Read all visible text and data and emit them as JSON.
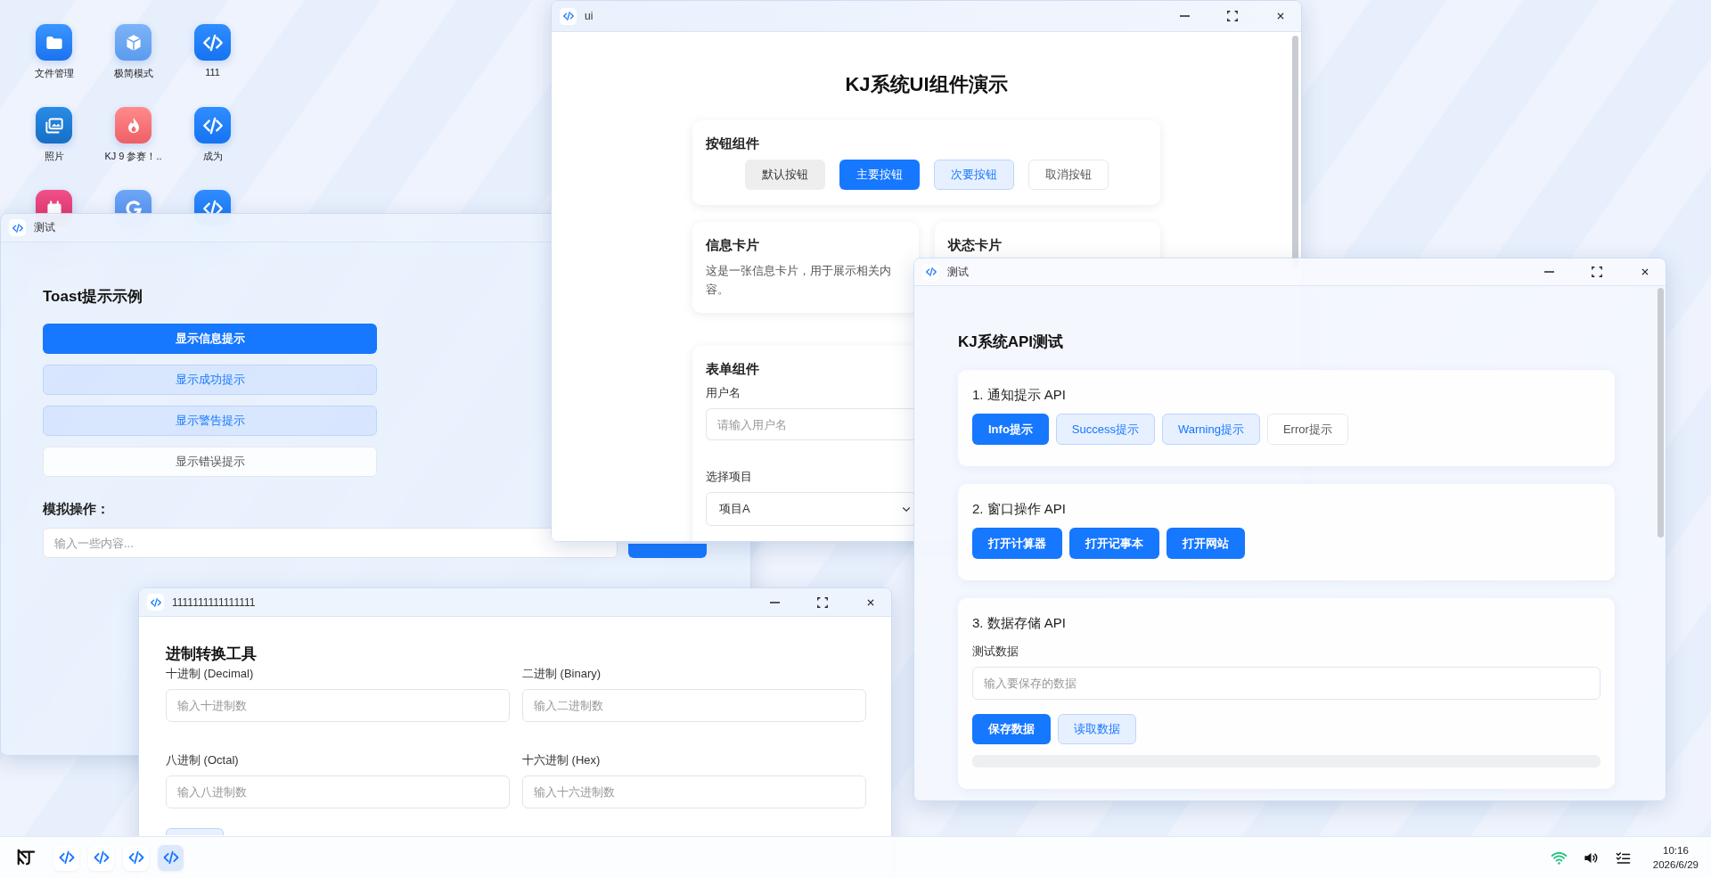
{
  "desktop_icons": [
    {
      "label": "文件管理",
      "kind": "folder"
    },
    {
      "label": "极简模式",
      "kind": "cube"
    },
    {
      "label": "111",
      "kind": "code"
    },
    {
      "label": "照片",
      "kind": "photos"
    },
    {
      "label": "KJ 9 参赛！..",
      "kind": "flame"
    },
    {
      "label": "成为",
      "kind": "code"
    },
    {
      "kind": "calendar"
    },
    {
      "kind": "g"
    },
    {
      "kind": "code"
    }
  ],
  "toast_window": {
    "title": "测试",
    "heading": "Toast提示示例",
    "buttons": [
      {
        "label": "显示信息提示",
        "kind": "primary"
      },
      {
        "label": "显示成功提示",
        "kind": "secondary"
      },
      {
        "label": "显示警告提示",
        "kind": "secondary"
      },
      {
        "label": "显示错误提示",
        "kind": "plain"
      }
    ],
    "section_label": "模拟操作：",
    "input_placeholder": "输入一些内容..."
  },
  "ui_window": {
    "title": "ui",
    "heading": "KJ系统UI组件演示",
    "button_card": {
      "title": "按钮组件",
      "buttons": [
        {
          "label": "默认按钮",
          "kind": "default"
        },
        {
          "label": "主要按钮",
          "kind": "primary"
        },
        {
          "label": "次要按钮",
          "kind": "secondary"
        },
        {
          "label": "取消按钮",
          "kind": "plain"
        }
      ]
    },
    "info_card": {
      "title": "信息卡片",
      "text": "这是一张信息卡片，用于展示相关内容。"
    },
    "status_card": {
      "title": "状态卡片"
    },
    "form_card": {
      "title": "表单组件",
      "fields": [
        {
          "label": "用户名",
          "kind": "text",
          "placeholder": "请输入用户名"
        },
        {
          "label": "选择项目",
          "kind": "select",
          "value": "项目A"
        }
      ]
    }
  },
  "converter_window": {
    "title": "1111111111111111",
    "heading": "进制转换工具",
    "fields": [
      {
        "label": "十进制 (Decimal)",
        "placeholder": "输入十进制数"
      },
      {
        "label": "二进制 (Binary)",
        "placeholder": "输入二进制数"
      },
      {
        "label": "八进制 (Octal)",
        "placeholder": "输入八进制数"
      },
      {
        "label": "十六进制 (Hex)",
        "placeholder": "输入十六进制数"
      }
    ]
  },
  "api_window": {
    "title": "测试",
    "heading": "KJ系统API测试",
    "sections": [
      {
        "title": "1. 通知提示 API",
        "buttons": [
          {
            "label": "Info提示",
            "kind": "primary"
          },
          {
            "label": "Success提示",
            "kind": "secondary"
          },
          {
            "label": "Warning提示",
            "kind": "secondary"
          },
          {
            "label": "Error提示",
            "kind": "plain"
          }
        ]
      },
      {
        "title": "2. 窗口操作 API",
        "buttons": [
          {
            "label": "打开计算器",
            "kind": "primary"
          },
          {
            "label": "打开记事本",
            "kind": "primary"
          },
          {
            "label": "打开网站",
            "kind": "primary"
          }
        ]
      },
      {
        "title": "3. 数据存储 API",
        "field_label": "测试数据",
        "placeholder": "输入要保存的数据",
        "buttons": [
          {
            "label": "保存数据",
            "kind": "primary"
          },
          {
            "label": "读取数据",
            "kind": "secondary"
          }
        ]
      }
    ]
  },
  "taskbar": {
    "apps": [
      {
        "selected": false
      },
      {
        "selected": false
      },
      {
        "selected": false
      },
      {
        "selected": true
      }
    ],
    "clock": {
      "time": "10:16",
      "date": "2026/6/29"
    }
  }
}
